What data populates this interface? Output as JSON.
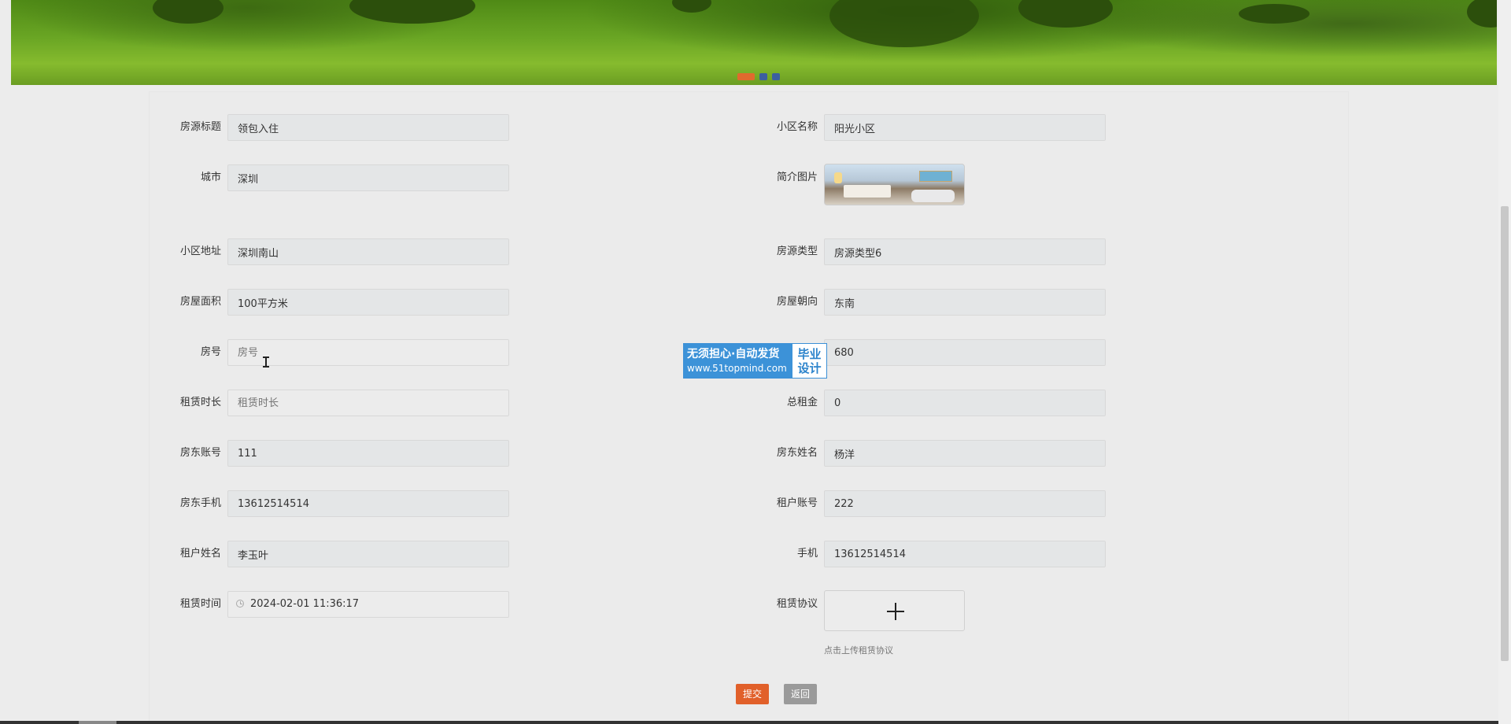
{
  "form": {
    "left": [
      {
        "label": "房源标题",
        "value": "领包入住",
        "placeholder": ""
      },
      {
        "label": "城市",
        "value": "深圳",
        "placeholder": ""
      },
      {
        "label": "小区地址",
        "value": "深圳南山",
        "placeholder": ""
      },
      {
        "label": "房屋面积",
        "value": "100平方米",
        "placeholder": ""
      },
      {
        "label": "房号",
        "value": "",
        "placeholder": "房号"
      },
      {
        "label": "租赁时长",
        "value": "",
        "placeholder": "租赁时长"
      },
      {
        "label": "房东账号",
        "value": "111",
        "placeholder": ""
      },
      {
        "label": "房东手机",
        "value": "13612514514",
        "placeholder": ""
      },
      {
        "label": "租户姓名",
        "value": "李玉叶",
        "placeholder": ""
      },
      {
        "label": "租赁时间",
        "value": "2024-02-01 11:36:17",
        "placeholder": ""
      }
    ],
    "right": [
      {
        "label": "小区名称",
        "value": "阳光小区"
      },
      {
        "label": "简介图片",
        "value": ""
      },
      {
        "label": "房源类型",
        "value": "房源类型6"
      },
      {
        "label": "房屋朝向",
        "value": "东南"
      },
      {
        "label": "",
        "value": "680"
      },
      {
        "label": "总租金",
        "value": "0"
      },
      {
        "label": "房东姓名",
        "value": "杨洋"
      },
      {
        "label": "租户账号",
        "value": "222"
      },
      {
        "label": "手机",
        "value": "13612514514"
      },
      {
        "label": "租赁协议",
        "value": ""
      }
    ],
    "upload_hint": "点击上传租赁协议"
  },
  "buttons": {
    "submit": "提交",
    "back": "返回"
  },
  "watermark": {
    "line1": "无须担心·自动发货",
    "line2": "www.51topmind.com",
    "badge1": "毕业",
    "badge2": "设计"
  },
  "icons": {
    "time": "clock-icon",
    "upload": "plus-icon"
  },
  "colors": {
    "submit": "#e1602a",
    "back": "#9a9a9a",
    "accent_dot": "#e06a2e",
    "dot": "#3c5fa0"
  }
}
